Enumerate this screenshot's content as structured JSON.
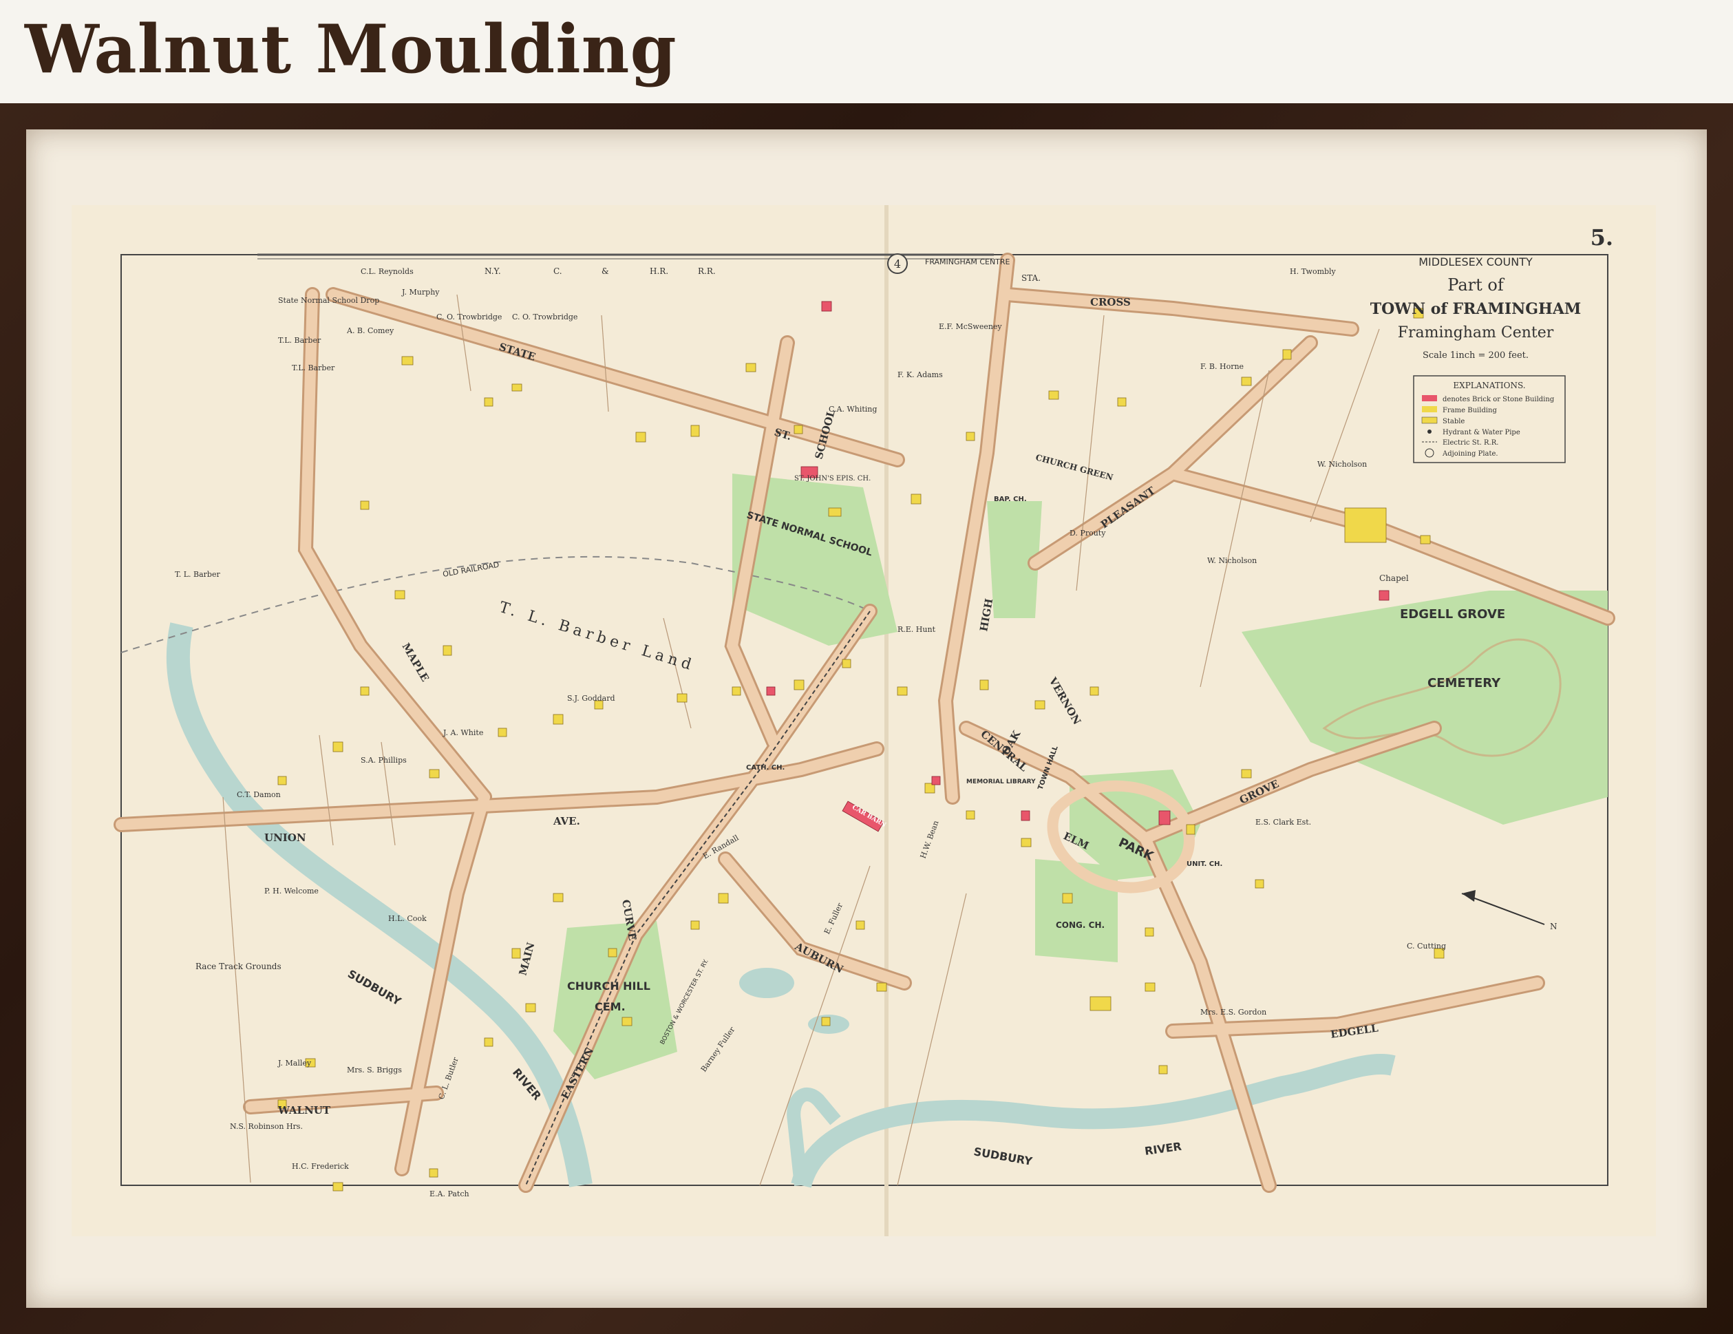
{
  "header": {
    "title": "Walnut Moulding"
  },
  "map": {
    "plate_number": "5.",
    "county": "MIDDLESEX COUNTY",
    "title_line1": "Part of",
    "title_line2": "TOWN of FRAMINGHAM",
    "title_line3": "Framingham Center",
    "scale": "Scale 1inch = 200 feet.",
    "legend": {
      "heading": "EXPLANATIONS.",
      "items": [
        {
          "label": "denotes Brick or Stone Building",
          "color": "#e8566b"
        },
        {
          "label": "Frame Building",
          "color": "#f0d84a"
        },
        {
          "label": "Stable",
          "color": "#f0d84a"
        },
        {
          "label": "Hydrant & Water Pipe",
          "color": "#333333"
        },
        {
          "label": "Electric St. R.R.",
          "color": "#333333"
        },
        {
          "label": "Adjoining Plate.",
          "color": "#333333"
        }
      ]
    },
    "colors": {
      "paper": "#f4ebd7",
      "road": "#efcfae",
      "road_edge": "#c79a74",
      "green": "#bfe0a8",
      "water": "#b8d6cf",
      "frame_building": "#f0d84a",
      "brick_building": "#e8566b"
    },
    "streets": {
      "state": "STATE",
      "st": "ST.",
      "cross": "CROSS",
      "pleasant": "PLEASANT",
      "grove": "GROVE",
      "union": "UNION",
      "ave": "AVE.",
      "maple": "MAPLE",
      "main": "MAIN",
      "curve": "CURVE",
      "auburn": "AUBURN",
      "elm": "ELM",
      "edgell": "EDGELL",
      "walnut": "WALNUT",
      "eastern": "EASTERN",
      "high": "HIGH",
      "vernon": "VERNON",
      "central": "CENTRAL",
      "oak": "OAK",
      "school": "SCHOOL",
      "church_green": "CHURCH GREEN"
    },
    "places": {
      "edgell_grove": "EDGELL GROVE",
      "cemetery": "CEMETERY",
      "chapel": "Chapel",
      "park": "PARK",
      "state_normal_school": "STATE NORMAL SCHOOL",
      "church_hill": "CHURCH HILL",
      "cem": "CEM.",
      "sudbury_river": "SUDBURY",
      "river": "RIVER",
      "framingham_centre": "FRAMINGHAM CENTRE",
      "adjoining_4": "4",
      "barber_land": "T. L. Barber Land",
      "race_track": "Race Track Grounds",
      "old_railroad": "OLD RAILROAD",
      "cong_ch": "CONG. CH.",
      "town_hall": "TOWN HALL",
      "memorial_library": "MEMORIAL LIBRARY",
      "bap_ch": "BAP. CH.",
      "cath_ch": "CATH. CH.",
      "unit_ch": "UNIT. CH.",
      "car_barn": "CAR BARN",
      "railroad_label": "BOSTON & WORCESTER ST. RY.",
      "st_johns": "ST. JOHN'S EPIS. CH."
    },
    "owners": {
      "tl_barber_1": "T. L. Barber",
      "tl_barber_2": "T.L. Barber",
      "tl_barber_3": "T.L. Barber",
      "co_trowbridge": "C. O. Trowbridge",
      "co_trowbridge_2": "C. O. Trowbridge",
      "d_prouty": "D. Prouty",
      "w_nicholson": "W. Nicholson",
      "w_nicholson_2": "W. Nicholson",
      "fb_horne": "F. B. Horne",
      "h_twombly": "H. Twombly",
      "ph_welcome": "P. H. Welcome",
      "ja_white": "J. A. White",
      "sa_phillips": "S.A. Phillips",
      "ct_damon": "C.T. Damon",
      "hl_cook": "H.L. Cook",
      "cl_butler": "C. L. Butler",
      "hc_frederick": "H.C. Frederick",
      "ea_patch": "E.A. Patch",
      "mrs_es_gordon": "Mrs. E.S. Gordon",
      "es_clark": "E.S. Clark Est.",
      "c_cutting": "C. Cutting",
      "barney_fuller": "Barney Fuller",
      "e_fuller": "E. Fuller",
      "ef_mcsweeney": "E.F. McSweeney",
      "fk_adams": "F. K. Adams",
      "ca_whiting": "C.A. Whiting",
      "hw_bean": "H.W. Bean",
      "ns_robinson": "N.S. Robinson Hrs.",
      "j_malley": "J. Malley",
      "mrs_s_briggs": "Mrs. S. Briggs",
      "ab_comey": "A. B. Comey",
      "cl_reynolds": "C.L. Reynolds",
      "j_murphy": "J. Murphy",
      "re_hunt": "R.E. Hunt",
      "e_randall": "E. Randall",
      "sj_goddard": "S.J. Goddard"
    },
    "misc": {
      "ny": "N.Y.",
      "c": "C.",
      "amp": "&",
      "hr": "H.R.",
      "rr": "R.R.",
      "state_normal_drop": "State Normal School Drop",
      "north": "N",
      "sta": "STA."
    }
  }
}
